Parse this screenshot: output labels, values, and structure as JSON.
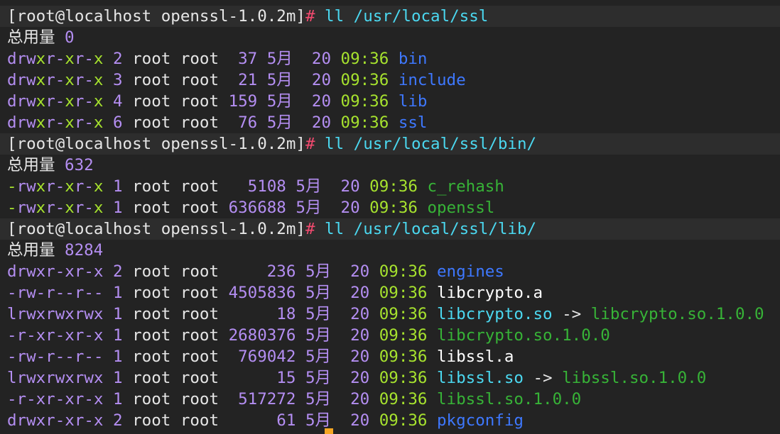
{
  "colors": {
    "background": "#232323",
    "prompt_bg": "#2d2d2d",
    "text": "#e6e6e6",
    "purple": "#b48ef2",
    "red": "#f34a6f",
    "lime": "#a6e22e",
    "blue_dir": "#3e78ff",
    "cyan_link": "#4bd8f0",
    "green_exec": "#37b337",
    "cursor": "#f5a623"
  },
  "prompt": "[root@localhost openssl-1.0.2m]",
  "hash": "#",
  "commands": [
    " ll /usr/local/ssl",
    " ll /usr/local/ssl/bin/",
    " ll /usr/local/ssl/lib/"
  ],
  "total_label": "总用量 ",
  "totals": [
    "0",
    "632",
    "8284"
  ],
  "listing_ssl": [
    {
      "type": "d",
      "p1": "rw",
      "p2": "x",
      "p3": "r-",
      "p4": "x",
      "p5": "r-",
      "p6": "x",
      "links": " 2",
      "user": " root root",
      "size": "  37",
      "month": " 5月",
      "day": "  20",
      "time": " 09:36",
      "name": " bin"
    },
    {
      "type": "d",
      "p1": "rw",
      "p2": "x",
      "p3": "r-",
      "p4": "x",
      "p5": "r-",
      "p6": "x",
      "links": " 3",
      "user": " root root",
      "size": "  21",
      "month": " 5月",
      "day": "  20",
      "time": " 09:36",
      "name": " include"
    },
    {
      "type": "d",
      "p1": "rw",
      "p2": "x",
      "p3": "r-",
      "p4": "x",
      "p5": "r-",
      "p6": "x",
      "links": " 4",
      "user": " root root",
      "size": " 159",
      "month": " 5月",
      "day": "  20",
      "time": " 09:36",
      "name": " lib"
    },
    {
      "type": "d",
      "p1": "rw",
      "p2": "x",
      "p3": "r-",
      "p4": "x",
      "p5": "r-",
      "p6": "x",
      "links": " 6",
      "user": " root root",
      "size": "  76",
      "month": " 5月",
      "day": "  20",
      "time": " 09:36",
      "name": " ssl"
    }
  ],
  "listing_bin": [
    {
      "type": "-",
      "p1": "rw",
      "p2": "x",
      "p3": "r-",
      "p4": "x",
      "p5": "r-",
      "p6": "x",
      "links": " 1",
      "user": " root root",
      "size": "   5108",
      "month": " 5月",
      "day": "  20",
      "time": " 09:36",
      "name": " c_rehash"
    },
    {
      "type": "-",
      "p1": "rw",
      "p2": "x",
      "p3": "r-",
      "p4": "x",
      "p5": "r-",
      "p6": "x",
      "links": " 1",
      "user": " root root",
      "size": " 636688",
      "month": " 5月",
      "day": "  20",
      "time": " 09:36",
      "name": " openssl"
    }
  ],
  "listing_lib": [
    {
      "perm": "drwxr-xr-x",
      "links": " 2",
      "user": " root root",
      "size": "     236",
      "month": " 5月",
      "day": "  20",
      "time": " 09:36",
      "name": " engines"
    },
    {
      "perm": "-rw-r--r--",
      "links": " 1",
      "user": " root root",
      "size": " 4505836",
      "month": " 5月",
      "day": "  20",
      "time": " 09:36",
      "name": " libcrypto.a"
    },
    {
      "perm": "lrwxrwxrwx",
      "links": " 1",
      "user": " root root",
      "size": "      18",
      "month": " 5月",
      "day": "  20",
      "time": " 09:36",
      "name": " libcrypto.so",
      "arrow": " ->",
      "target": " libcrypto.so.1.0.0"
    },
    {
      "perm": "-r-xr-xr-x",
      "links": " 1",
      "user": " root root",
      "size": " 2680376",
      "month": " 5月",
      "day": "  20",
      "time": " 09:36",
      "name": " libcrypto.so.1.0.0"
    },
    {
      "perm": "-rw-r--r--",
      "links": " 1",
      "user": " root root",
      "size": "  769042",
      "month": " 5月",
      "day": "  20",
      "time": " 09:36",
      "name": " libssl.a"
    },
    {
      "perm": "lrwxrwxrwx",
      "links": " 1",
      "user": " root root",
      "size": "      15",
      "month": " 5月",
      "day": "  20",
      "time": " 09:36",
      "name": " libssl.so",
      "arrow": " ->",
      "target": " libssl.so.1.0.0"
    },
    {
      "perm": "-r-xr-xr-x",
      "links": " 1",
      "user": " root root",
      "size": "  517272",
      "month": " 5月",
      "day": "  20",
      "time": " 09:36",
      "name": " libssl.so.1.0.0"
    },
    {
      "perm": "drwxr-xr-x",
      "links": " 2",
      "user": " root root",
      "size": "      61",
      "month": " 5月",
      "day": "  20",
      "time": " 09:36",
      "name": " pkgconfig"
    }
  ]
}
